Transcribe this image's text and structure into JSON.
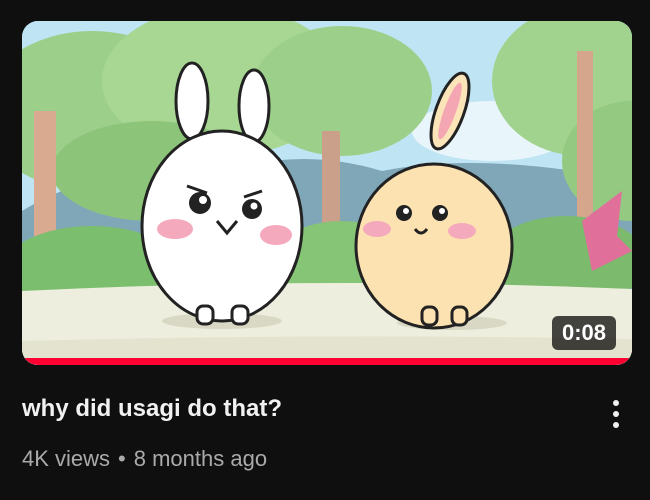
{
  "video": {
    "title": "why did usagi do that?",
    "views": "4K views",
    "separator": "•",
    "age": "8 months ago",
    "duration": "0:08",
    "watch_progress": 1.0
  },
  "icons": {
    "menu": "more-vert-icon"
  },
  "colors": {
    "background": "#0f0f0f",
    "title": "#f1f1f1",
    "meta": "#aaaaaa",
    "progress": "#ff0033"
  }
}
